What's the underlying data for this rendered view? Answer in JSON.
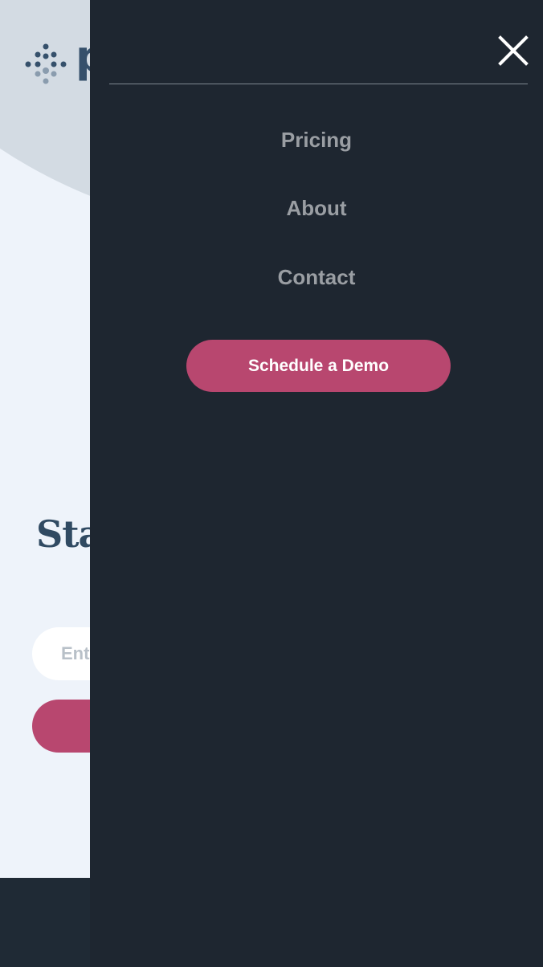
{
  "page": {
    "logo_text": "p",
    "hero_heading": "Start",
    "email_placeholder": "Enter your email",
    "cta_label": ""
  },
  "drawer": {
    "nav": [
      {
        "label": "Pricing"
      },
      {
        "label": "About"
      },
      {
        "label": "Contact"
      }
    ],
    "demo_label": "Schedule a Demo"
  },
  "colors": {
    "drawer_bg": "#1e2630",
    "accent": "#b8476f",
    "hero_blob": "#d3dbe3",
    "page_bg": "#eef3fa",
    "heading": "#304a62"
  },
  "icons": {
    "close": "close-icon",
    "logo": "logo-dots-icon"
  }
}
